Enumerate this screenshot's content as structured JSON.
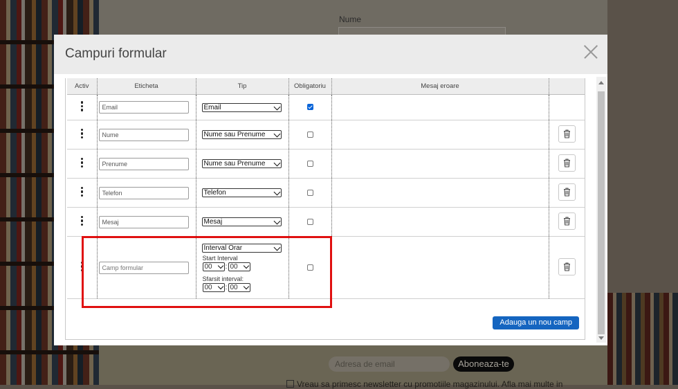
{
  "background": {
    "nume_label": "Nume",
    "email_placeholder": "Adresa de email",
    "subscribe_label": "Aboneaza-te",
    "newsletter_text": "Vreau sa primesc newsletter cu promotiile magazinului. Afla mai multe in"
  },
  "modal": {
    "title": "Campuri formular",
    "add_button": "Adauga un nou camp"
  },
  "table": {
    "headers": {
      "activ": "Activ",
      "eticheta": "Eticheta",
      "tip": "Tip",
      "obligatoriu": "Obligatoriu",
      "mesaj": "Mesaj eroare"
    },
    "rows": [
      {
        "label": "Email",
        "type": "Email",
        "required": true,
        "deletable": false
      },
      {
        "label": "Nume",
        "type": "Nume sau Prenume",
        "required": false,
        "deletable": true
      },
      {
        "label": "Prenume",
        "type": "Nume sau Prenume",
        "required": false,
        "deletable": true
      },
      {
        "label": "Telefon",
        "type": "Telefon",
        "required": false,
        "deletable": true
      },
      {
        "label": "Mesaj",
        "type": "Mesaj",
        "required": false,
        "deletable": true
      }
    ],
    "custom_row": {
      "placeholder": "Camp formular",
      "type": "Interval Orar",
      "start_label": "Start Interval",
      "start_hour": "00",
      "start_minute": "00",
      "end_label": "Sfarsit interval:",
      "end_hour": "00",
      "end_minute": "00",
      "colon": ":"
    }
  },
  "colors": {
    "accent": "#1565c0",
    "highlight": "#e01010"
  }
}
